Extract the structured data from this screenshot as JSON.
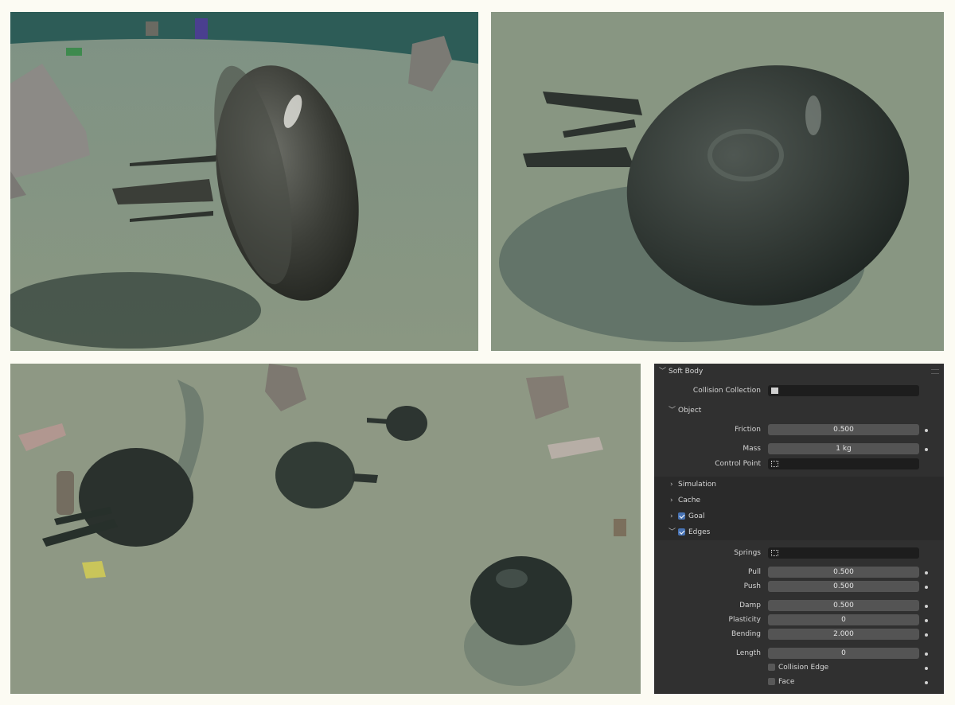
{
  "renders": [
    {
      "name": "jellyfish-closeup-side"
    },
    {
      "name": "jellyfish-closeup-top"
    },
    {
      "name": "jellyfish-group-overview"
    }
  ],
  "panel": {
    "title": "Soft Body",
    "collision_collection": {
      "label": "Collision Collection",
      "value": ""
    },
    "object": {
      "label": "Object",
      "friction": {
        "label": "Friction",
        "value": "0.500"
      },
      "mass": {
        "label": "Mass",
        "value": "1 kg"
      },
      "control_point": {
        "label": "Control Point",
        "value": ""
      }
    },
    "sections": {
      "simulation": "Simulation",
      "cache": "Cache",
      "goal": {
        "label": "Goal",
        "checked": true
      },
      "edges": {
        "label": "Edges",
        "checked": true
      }
    },
    "edges": {
      "springs": {
        "label": "Springs",
        "value": ""
      },
      "pull": {
        "label": "Pull",
        "value": "0.500"
      },
      "push": {
        "label": "Push",
        "value": "0.500"
      },
      "damp": {
        "label": "Damp",
        "value": "0.500"
      },
      "plasticity": {
        "label": "Plasticity",
        "value": "0"
      },
      "bending": {
        "label": "Bending",
        "value": "2.000"
      },
      "length": {
        "label": "Length",
        "value": "0"
      },
      "collision_edge": {
        "label": "Collision Edge",
        "checked": false
      },
      "face": {
        "label": "Face",
        "checked": false
      }
    },
    "colors": {
      "bg": "#303030",
      "field": "#545454",
      "dark_field": "#1d1d1d",
      "accent": "#4772b3"
    }
  }
}
